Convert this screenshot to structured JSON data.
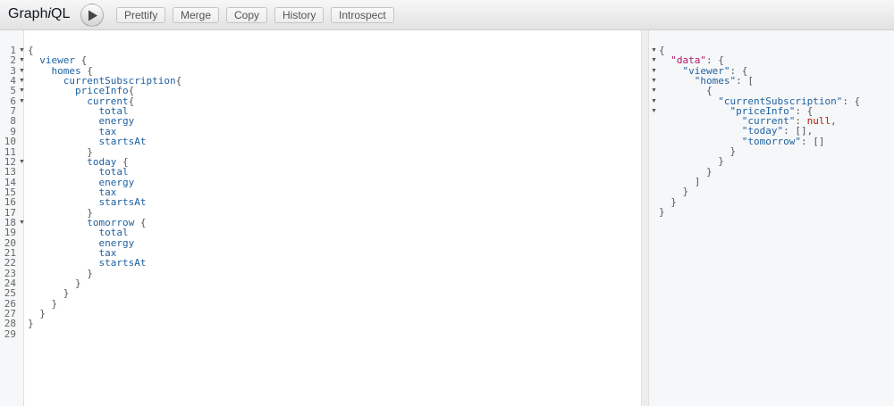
{
  "header": {
    "title_main": "Graph",
    "title_italic": "i",
    "title_end": "QL",
    "buttons": [
      "Prettify",
      "Merge",
      "Copy",
      "History",
      "Introspect"
    ]
  },
  "editor": {
    "lines": [
      {
        "num": "1",
        "fold": true,
        "indent": "",
        "field": "",
        "punct": "{"
      },
      {
        "num": "2",
        "fold": true,
        "indent": "  ",
        "field": "viewer",
        "punct": " {"
      },
      {
        "num": "3",
        "fold": true,
        "indent": "    ",
        "field": "homes",
        "punct": " {"
      },
      {
        "num": "4",
        "fold": true,
        "indent": "      ",
        "field": "currentSubscription",
        "punct": "{"
      },
      {
        "num": "5",
        "fold": true,
        "indent": "        ",
        "field": "priceInfo",
        "punct": "{"
      },
      {
        "num": "6",
        "fold": true,
        "indent": "          ",
        "field": "current",
        "punct": "{"
      },
      {
        "num": "7",
        "fold": false,
        "indent": "            ",
        "field": "total",
        "punct": ""
      },
      {
        "num": "8",
        "fold": false,
        "indent": "            ",
        "field": "energy",
        "punct": ""
      },
      {
        "num": "9",
        "fold": false,
        "indent": "            ",
        "field": "tax",
        "punct": ""
      },
      {
        "num": "10",
        "fold": false,
        "indent": "            ",
        "field": "startsAt",
        "punct": ""
      },
      {
        "num": "11",
        "fold": false,
        "indent": "          ",
        "field": "",
        "punct": "}"
      },
      {
        "num": "12",
        "fold": true,
        "indent": "          ",
        "field": "today",
        "punct": " {"
      },
      {
        "num": "13",
        "fold": false,
        "indent": "            ",
        "field": "total",
        "punct": ""
      },
      {
        "num": "14",
        "fold": false,
        "indent": "            ",
        "field": "energy",
        "punct": ""
      },
      {
        "num": "15",
        "fold": false,
        "indent": "            ",
        "field": "tax",
        "punct": ""
      },
      {
        "num": "16",
        "fold": false,
        "indent": "            ",
        "field": "startsAt",
        "punct": ""
      },
      {
        "num": "17",
        "fold": false,
        "indent": "          ",
        "field": "",
        "punct": "}"
      },
      {
        "num": "18",
        "fold": true,
        "indent": "          ",
        "field": "tomorrow",
        "punct": " {"
      },
      {
        "num": "19",
        "fold": false,
        "indent": "            ",
        "field": "total",
        "punct": ""
      },
      {
        "num": "20",
        "fold": false,
        "indent": "            ",
        "field": "energy",
        "punct": ""
      },
      {
        "num": "21",
        "fold": false,
        "indent": "            ",
        "field": "tax",
        "punct": ""
      },
      {
        "num": "22",
        "fold": false,
        "indent": "            ",
        "field": "startsAt",
        "punct": ""
      },
      {
        "num": "23",
        "fold": false,
        "indent": "          ",
        "field": "",
        "punct": "}"
      },
      {
        "num": "24",
        "fold": false,
        "indent": "        ",
        "field": "",
        "punct": "}"
      },
      {
        "num": "25",
        "fold": false,
        "indent": "      ",
        "field": "",
        "punct": "}"
      },
      {
        "num": "26",
        "fold": false,
        "indent": "    ",
        "field": "",
        "punct": "}"
      },
      {
        "num": "27",
        "fold": false,
        "indent": "  ",
        "field": "",
        "punct": "}"
      },
      {
        "num": "28",
        "fold": false,
        "indent": "",
        "field": "",
        "punct": "}"
      },
      {
        "num": "29",
        "fold": false,
        "indent": "",
        "field": "",
        "punct": ""
      }
    ]
  },
  "result": {
    "lines": [
      {
        "fold": true,
        "parts": [
          [
            "p",
            "{"
          ]
        ]
      },
      {
        "fold": true,
        "parts": [
          [
            "p",
            "  "
          ],
          [
            "d",
            "\"data\""
          ],
          [
            "p",
            ": {"
          ]
        ]
      },
      {
        "fold": true,
        "parts": [
          [
            "p",
            "    "
          ],
          [
            "k",
            "\"viewer\""
          ],
          [
            "p",
            ": {"
          ]
        ]
      },
      {
        "fold": true,
        "parts": [
          [
            "p",
            "      "
          ],
          [
            "k",
            "\"homes\""
          ],
          [
            "p",
            ": ["
          ]
        ]
      },
      {
        "fold": true,
        "parts": [
          [
            "p",
            "        {"
          ]
        ]
      },
      {
        "fold": true,
        "parts": [
          [
            "p",
            "          "
          ],
          [
            "k",
            "\"currentSubscription\""
          ],
          [
            "p",
            ": {"
          ]
        ]
      },
      {
        "fold": true,
        "parts": [
          [
            "p",
            "            "
          ],
          [
            "k",
            "\"priceInfo\""
          ],
          [
            "p",
            ": {"
          ]
        ]
      },
      {
        "fold": false,
        "parts": [
          [
            "p",
            "              "
          ],
          [
            "k",
            "\"current\""
          ],
          [
            "p",
            ": "
          ],
          [
            "n",
            "null"
          ],
          [
            "p",
            ","
          ]
        ]
      },
      {
        "fold": false,
        "parts": [
          [
            "p",
            "              "
          ],
          [
            "k",
            "\"today\""
          ],
          [
            "p",
            ": [],"
          ]
        ]
      },
      {
        "fold": false,
        "parts": [
          [
            "p",
            "              "
          ],
          [
            "k",
            "\"tomorrow\""
          ],
          [
            "p",
            ": []"
          ]
        ]
      },
      {
        "fold": false,
        "parts": [
          [
            "p",
            "            }"
          ]
        ]
      },
      {
        "fold": false,
        "parts": [
          [
            "p",
            "          }"
          ]
        ]
      },
      {
        "fold": false,
        "parts": [
          [
            "p",
            "        }"
          ]
        ]
      },
      {
        "fold": false,
        "parts": [
          [
            "p",
            "      ]"
          ]
        ]
      },
      {
        "fold": false,
        "parts": [
          [
            "p",
            "    }"
          ]
        ]
      },
      {
        "fold": false,
        "parts": [
          [
            "p",
            "  }"
          ]
        ]
      },
      {
        "fold": false,
        "parts": [
          [
            "p",
            "}"
          ]
        ]
      }
    ]
  },
  "icons": {
    "execute": "play-icon",
    "fold": "fold-arrow-icon"
  },
  "colors": {
    "field": "#1f61a0",
    "data_key": "#b0186a",
    "null": "#b11a04"
  }
}
